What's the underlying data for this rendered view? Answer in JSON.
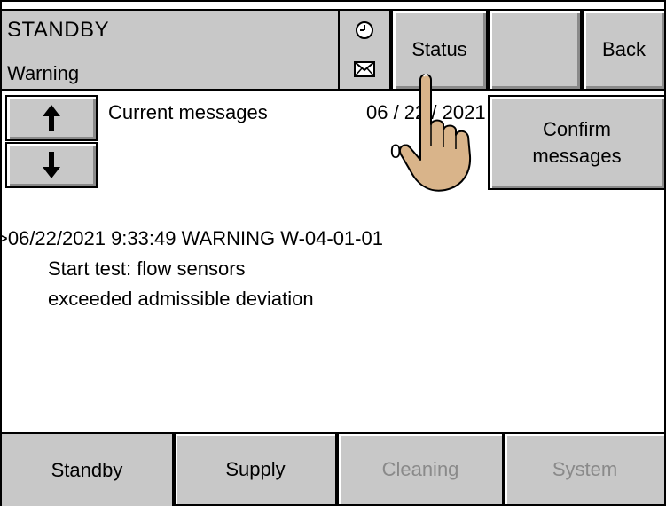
{
  "header": {
    "mode": "STANDBY",
    "state": "Warning",
    "clock_icon": "clock-icon",
    "mail_icon": "envelope-icon"
  },
  "nav": {
    "status_label": "Status",
    "blank_label": "",
    "back_label": "Back"
  },
  "messages": {
    "up_icon": "arrow-up-icon",
    "down_icon": "arrow-down-icon",
    "title": "Current messages",
    "date": "06 / 22 / 2021",
    "time": "09 : 04",
    "confirm_line1": "Confirm",
    "confirm_line2": "messages"
  },
  "log": {
    "line1": ">06/22/2021  9:33:49  WARNING W-04-01-01",
    "line2": "Start test: flow sensors",
    "line3": "exceeded admissible deviation"
  },
  "tabs": [
    {
      "label": "Standby",
      "state": "active"
    },
    {
      "label": "Supply",
      "state": "enabled"
    },
    {
      "label": "Cleaning",
      "state": "disabled"
    },
    {
      "label": "System",
      "state": "disabled"
    }
  ],
  "colors": {
    "panel_gray": "#c8c8c8",
    "disabled_text": "#8a8a8a",
    "hand_skin": "#d9b48a"
  }
}
